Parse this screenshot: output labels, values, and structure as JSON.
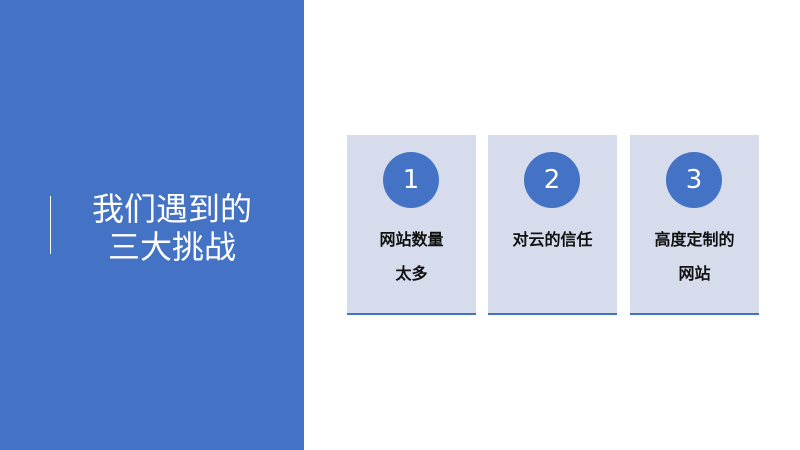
{
  "title": {
    "line1": "我们遇到的",
    "line2": "三大挑战"
  },
  "challenges": [
    {
      "number": "1",
      "line1": "网站数量",
      "line2": "太多"
    },
    {
      "number": "2",
      "line1": "对云的信任",
      "line2": ""
    },
    {
      "number": "3",
      "line1": "高度定制的",
      "line2": "网站"
    }
  ],
  "colors": {
    "accent": "#4472c4",
    "card_bg": "#d6dcec",
    "text": "#111111"
  }
}
